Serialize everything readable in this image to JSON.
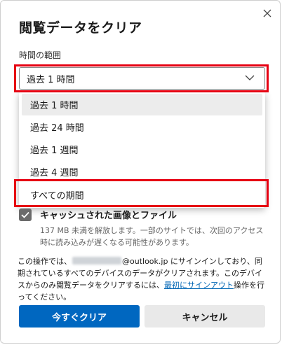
{
  "dialog": {
    "title": "閲覧データをクリア",
    "close_icon": "close-icon"
  },
  "time_range": {
    "label": "時間の範囲",
    "selected": "過去 1 時間",
    "options": [
      "過去 1 時間",
      "過去 24 時間",
      "過去 1 週間",
      "過去 4 週間",
      "すべての期間"
    ]
  },
  "cache_option": {
    "checked": true,
    "title": "キャッシュされた画像とファイル",
    "description": "137 MB 未満を解放します。一部のサイトでは、次回のアクセス時に読み込みが遅くなる可能性があります。"
  },
  "notice": {
    "prefix": "この操作では、",
    "account_suffix": "@outlook.jp",
    "middle": " にサインインしており、同期されているすべてのデバイスのデータがクリアされます。このデバイスからのみ閲覧データをクリアするには、",
    "link": "最初にサインアウト",
    "suffix": "操作を行ってください。"
  },
  "buttons": {
    "primary": "今すぐクリア",
    "secondary": "キャンセル"
  },
  "colors": {
    "accent": "#0067c0",
    "highlight": "#e60012",
    "link": "#0066b4"
  }
}
